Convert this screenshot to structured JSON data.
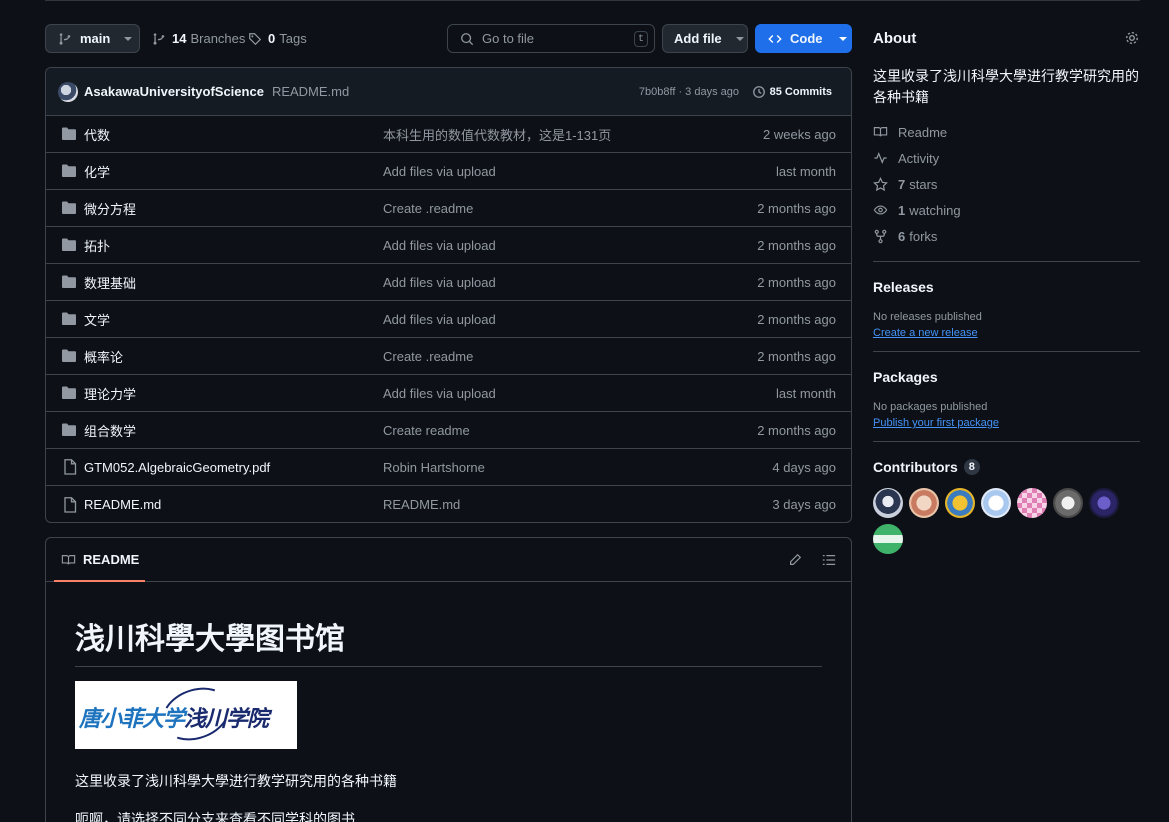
{
  "toolbar": {
    "branch": "main",
    "branches_count": "14",
    "branches_label": "Branches",
    "tags_count": "0",
    "tags_label": "Tags",
    "search_placeholder": "Go to file",
    "search_shortcut": "t",
    "add_file_label": "Add file",
    "code_label": "Code"
  },
  "commit": {
    "author": "AsakawaUniversityofScience",
    "message": "README.md",
    "sha_time": "7b0b8ff · 3 days ago",
    "commits_label": "85 Commits"
  },
  "files": [
    {
      "type": "folder",
      "name": "代数",
      "message": "本科生用的数值代数教材，这是1-131页",
      "age": "2 weeks ago"
    },
    {
      "type": "folder",
      "name": "化学",
      "message": "Add files via upload",
      "age": "last month"
    },
    {
      "type": "folder",
      "name": "微分方程",
      "message": "Create .readme",
      "age": "2 months ago"
    },
    {
      "type": "folder",
      "name": "拓扑",
      "message": "Add files via upload",
      "age": "2 months ago"
    },
    {
      "type": "folder",
      "name": "数理基础",
      "message": "Add files via upload",
      "age": "2 months ago"
    },
    {
      "type": "folder",
      "name": "文学",
      "message": "Add files via upload",
      "age": "2 months ago"
    },
    {
      "type": "folder",
      "name": "概率论",
      "message": "Create .readme",
      "age": "2 months ago"
    },
    {
      "type": "folder",
      "name": "理论力学",
      "message": "Add files via upload",
      "age": "last month"
    },
    {
      "type": "folder",
      "name": "组合数学",
      "message": "Create readme",
      "age": "2 months ago"
    },
    {
      "type": "file",
      "name": "GTM052.AlgebraicGeometry.pdf",
      "message": "Robin Hartshorne",
      "age": "4 days ago"
    },
    {
      "type": "file",
      "name": "README.md",
      "message": "README.md",
      "age": "3 days ago"
    }
  ],
  "readme": {
    "tab_label": "README",
    "heading": "浅川科學大學图书馆",
    "logo_text_a": "唐小菲大学",
    "logo_text_b": "浅川学院",
    "paragraph1": "这里收录了浅川科學大學进行教学研究用的各种书籍",
    "paragraph2": "呃啊，请选择不同分支来查看不同学科的图书"
  },
  "about": {
    "title": "About",
    "description": "这里收录了浅川科學大學进行教学研究用的各种书籍",
    "readme_label": "Readme",
    "activity_label": "Activity",
    "stars_count": "7",
    "stars_label": "stars",
    "watching_count": "1",
    "watching_label": "watching",
    "forks_count": "6",
    "forks_label": "forks"
  },
  "releases": {
    "title": "Releases",
    "note": "No releases published",
    "link": "Create a new release"
  },
  "packages": {
    "title": "Packages",
    "note": "No packages published",
    "link": "Publish your first package"
  },
  "contributors": {
    "title": "Contributors",
    "count": "8",
    "avatars": [
      {
        "bg": "radial-gradient(circle at 50% 45%, #e8ecf2 0 25%, #2a3550 26% 55%, #c9d0dc 56%)"
      },
      {
        "bg": "radial-gradient(circle at 50% 50%, #f2d7c4 0 35%, #c97b62 36% 60%, #e9c3a8 61%)"
      },
      {
        "bg": "radial-gradient(circle at 50% 50%, #f2c230 0 35%, #3b7bbf 36% 60%, #e7b52a 61%)"
      },
      {
        "bg": "radial-gradient(circle at 50% 50%, #ffffff 0 35%, #a9c8f0 36% 60%, #dfe9f7 61%)"
      },
      {
        "bg": "repeating-conic-gradient(#e07fb4 0 25%, #f6d3e6 0 50%) 0 0/10px 10px"
      },
      {
        "bg": "radial-gradient(circle at 50% 50%, #f0f0f0 0 30%, #6b6b6b 31% 60%, #4a4a4a 61%)"
      },
      {
        "bg": "radial-gradient(circle at 50% 50%, #6d5fc9 0 30%, #2b2466 31% 60%, #1c1a3d 61%)"
      },
      {
        "bg": "linear-gradient(#e8f5ec,#e8f5ec) center/30px 8px no-repeat, linear-gradient(#3fb36a,#3fb36a)"
      }
    ]
  }
}
